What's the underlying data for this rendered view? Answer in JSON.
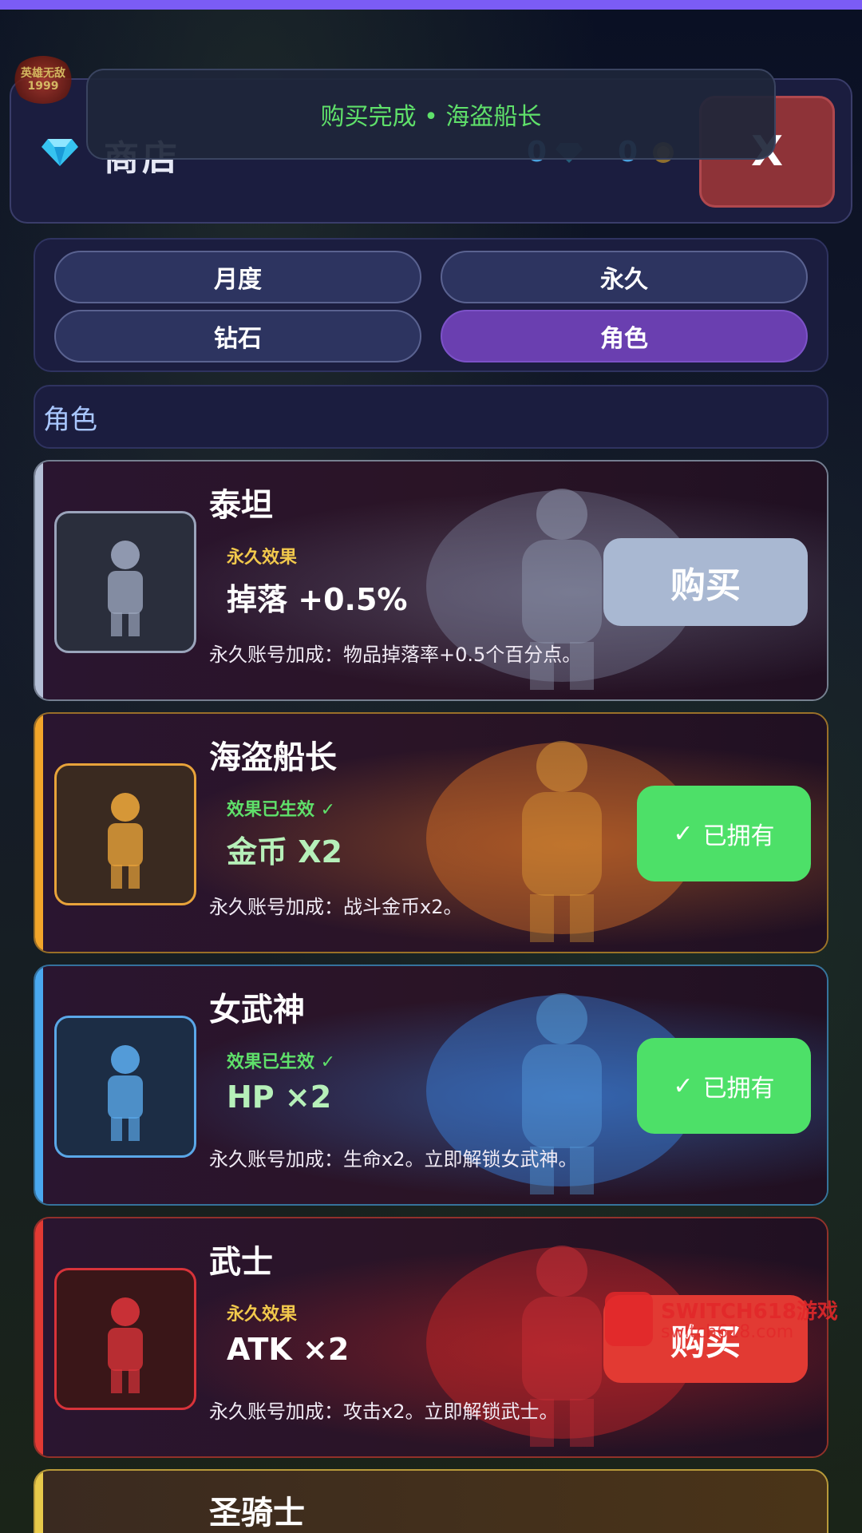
{
  "header": {
    "title": "商店",
    "gems": "0",
    "coins": "0",
    "close_label": "X",
    "game_logo": "英雄无敌1999"
  },
  "toast": {
    "text": "购买完成 • 海盗船长"
  },
  "tabs": [
    {
      "label": "月度",
      "active": false
    },
    {
      "label": "永久",
      "active": false
    },
    {
      "label": "钻石",
      "active": false
    },
    {
      "label": "角色",
      "active": true
    }
  ],
  "section": {
    "label": "角色"
  },
  "cards": [
    {
      "name": "泰坦",
      "effect_tag": "永久效果",
      "effect_value": "掉落 +0.5%",
      "desc": "永久账号加成：物品掉落率+0.5个百分点。",
      "status": "buy",
      "button": "购买",
      "accent": "#b4bfd6",
      "tag_color": "#f2c94c",
      "value_color": "#ffffff",
      "button_color": "#a9b8d2",
      "portrait_bg": "#2a2e3c",
      "portrait_border": "#9aa4bb",
      "glow": "rgba(150,160,190,0.35)"
    },
    {
      "name": "海盗船长",
      "effect_tag": "效果已生效 ✓",
      "effect_value": "金币 X2",
      "desc": "永久账号加成：战斗金币x2。",
      "status": "owned",
      "button": "已拥有",
      "button_icon": "✓",
      "accent": "#f2a52a",
      "tag_color": "#5fe06a",
      "value_color": "#b6f0b9",
      "button_color": "#4de068",
      "portrait_bg": "#3a2a20",
      "portrait_border": "#e8a33a",
      "glow": "rgba(230,120,40,0.45)"
    },
    {
      "name": "女武神",
      "effect_tag": "效果已生效 ✓",
      "effect_value": "HP ×2",
      "desc": "永久账号加成：生命x2。立即解锁女武神。",
      "status": "owned",
      "button": "已拥有",
      "button_icon": "✓",
      "accent": "#4aa8ef",
      "tag_color": "#5fe06a",
      "value_color": "#b6f0b9",
      "button_color": "#4de068",
      "portrait_bg": "#1c2d45",
      "portrait_border": "#5aa7e8",
      "glow": "rgba(60,140,240,0.45)"
    },
    {
      "name": "武士",
      "effect_tag": "永久效果",
      "effect_value": "ATK ×2",
      "desc": "永久账号加成：攻击x2。立即解锁武士。",
      "status": "buy",
      "button": "购买",
      "accent": "#e23a33",
      "tag_color": "#f2c94c",
      "value_color": "#ffffff",
      "button_color": "#e23a33",
      "portrait_bg": "#3a1618",
      "portrait_border": "#d8333a",
      "glow": "rgba(220,40,40,0.45)"
    }
  ],
  "partial_card": {
    "name": "圣骑士"
  },
  "watermark": {
    "line1": "SWITCH618游戏",
    "line2": "switch618.com"
  }
}
